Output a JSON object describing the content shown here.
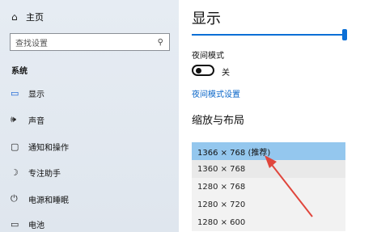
{
  "sidebar": {
    "home": {
      "label": "主页",
      "icon": "home-icon"
    },
    "search": {
      "placeholder": "查找设置",
      "icon": "search-icon"
    },
    "section_title": "系统",
    "items": [
      {
        "label": "显示",
        "icon": "display-icon",
        "active": true
      },
      {
        "label": "声音",
        "icon": "sound-icon"
      },
      {
        "label": "通知和操作",
        "icon": "notification-icon"
      },
      {
        "label": "专注助手",
        "icon": "moon-icon"
      },
      {
        "label": "电源和睡眠",
        "icon": "power-icon"
      },
      {
        "label": "电池",
        "icon": "battery-icon"
      }
    ]
  },
  "main": {
    "title": "显示",
    "brightness_level": 1.0,
    "night_mode": {
      "label": "夜间模式",
      "state": "关",
      "on": false
    },
    "night_mode_link": "夜间模式设置",
    "scale_layout_title": "缩放与布局",
    "resolution_options": [
      {
        "label": "1366 × 768 (推荐)",
        "selected": true
      },
      {
        "label": "1360 × 768"
      },
      {
        "label": "1280 × 768"
      },
      {
        "label": "1280 × 720"
      },
      {
        "label": "1280 × 600"
      }
    ]
  },
  "colors": {
    "accent": "#0b6fd6",
    "selected": "#94c7ee",
    "annotation_arrow": "#e0463c"
  }
}
